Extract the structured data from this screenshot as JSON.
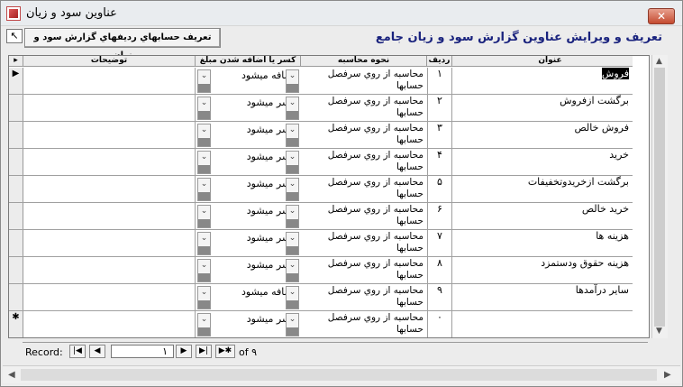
{
  "window": {
    "title": "عناوين سود و زيان",
    "close_label": "✕"
  },
  "header": {
    "form_title": "تعريف و ويرايش عناوين گزارش سود و زيان جامع",
    "report_button_label": "تعريف حسابهاي رديفهاي گزارش سود و زيان",
    "tool_icon": "↖"
  },
  "columns": {
    "title": "عنوان",
    "row": "رديف",
    "calc": "نحوه محاسبه",
    "sign": "كسر يا اضافه شدن مبلغ",
    "notes": "توضيحات"
  },
  "rows": [
    {
      "selector": "▶",
      "title": "فروش",
      "row": "۱",
      "calc": "محاسبه از روي سرفصل حسابها",
      "sign": "اضافه ميشود",
      "notes": ""
    },
    {
      "selector": "",
      "title": "برگشت ازفروش",
      "row": "۲",
      "calc": "محاسبه از روي سرفصل حسابها",
      "sign": "كسر ميشود",
      "notes": ""
    },
    {
      "selector": "",
      "title": "فروش خالص",
      "row": "۳",
      "calc": "محاسبه از روي سرفصل حسابها",
      "sign": "كسر ميشود",
      "notes": ""
    },
    {
      "selector": "",
      "title": "خريد",
      "row": "۴",
      "calc": "محاسبه از روي سرفصل حسابها",
      "sign": "كسر ميشود",
      "notes": ""
    },
    {
      "selector": "",
      "title": "برگشت ازخريدوتخفيفات",
      "row": "۵",
      "calc": "محاسبه از روي سرفصل حسابها",
      "sign": "كسر ميشود",
      "notes": ""
    },
    {
      "selector": "",
      "title": "خريد خالص",
      "row": "۶",
      "calc": "محاسبه از روي سرفصل حسابها",
      "sign": "كسر ميشود",
      "notes": ""
    },
    {
      "selector": "",
      "title": "هزينه ها",
      "row": "۷",
      "calc": "محاسبه از روي سرفصل حسابها",
      "sign": "كسر ميشود",
      "notes": ""
    },
    {
      "selector": "",
      "title": "هزينه حقوق ودستمزد",
      "row": "۸",
      "calc": "محاسبه از روي سرفصل حسابها",
      "sign": "كسر ميشود",
      "notes": ""
    },
    {
      "selector": "",
      "title": "ساير درآمدها",
      "row": "۹",
      "calc": "محاسبه از روي سرفصل حسابها",
      "sign": "اضافه ميشود",
      "notes": ""
    },
    {
      "selector": "✱",
      "title": "",
      "row": "۰",
      "calc": "محاسبه از روي سرفصل حسابها",
      "sign": "كسر ميشود",
      "notes": ""
    }
  ],
  "nav": {
    "record_label": "Record:",
    "first": "|◀",
    "prev": "◀",
    "current": "۱",
    "next": "▶",
    "last": "▶|",
    "new": "▶✱",
    "of_label": "of ۹"
  },
  "scroll": {
    "up": "▲",
    "down": "▼",
    "left": "◀",
    "right": "▶"
  }
}
